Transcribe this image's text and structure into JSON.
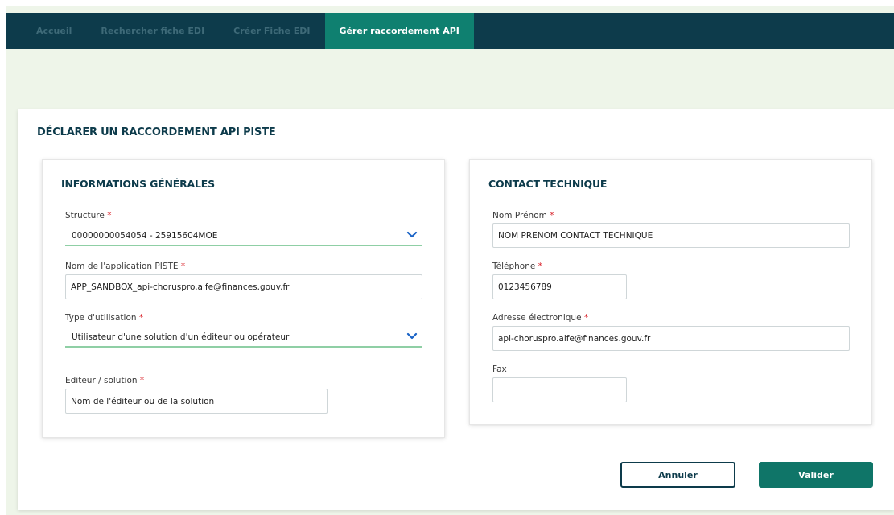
{
  "nav": {
    "tabs": [
      {
        "label": "Accueil",
        "active": false
      },
      {
        "label": "Rechercher fiche EDI",
        "active": false
      },
      {
        "label": "Créer Fiche EDI",
        "active": false
      },
      {
        "label": "Gérer raccordement API",
        "active": true
      }
    ]
  },
  "page": {
    "title": "DÉCLARER UN RACCORDEMENT API PISTE"
  },
  "general": {
    "title": "INFORMATIONS GÉNÉRALES",
    "structure": {
      "label": "Structure",
      "required": "*",
      "value": "00000000054054 - 25915604MOE"
    },
    "app_name": {
      "label": "Nom de l'application PISTE",
      "required": "*",
      "value": "APP_SANDBOX_api-choruspro.aife@finances.gouv.fr"
    },
    "usage_type": {
      "label": "Type d'utilisation",
      "required": "*",
      "value": "Utilisateur d'une solution d'un éditeur ou opérateur"
    },
    "editor": {
      "label": "Editeur / solution",
      "required": "*",
      "placeholder": "Nom de l'éditeur ou de la solution",
      "value": ""
    }
  },
  "contact": {
    "title": "CONTACT TECHNIQUE",
    "name": {
      "label": "Nom Prénom",
      "required": "*",
      "value": "NOM PRENOM CONTACT TECHNIQUE"
    },
    "phone": {
      "label": "Téléphone",
      "required": "*",
      "value": "0123456789"
    },
    "email": {
      "label": "Adresse électronique",
      "required": "*",
      "value": "api-choruspro.aife@finances.gouv.fr"
    },
    "fax": {
      "label": "Fax",
      "value": ""
    }
  },
  "actions": {
    "cancel_label": "Annuler",
    "submit_label": "Valider"
  },
  "colors": {
    "nav_bg": "#0d3b4b",
    "nav_active": "#0f8070",
    "accent": "#0f7568",
    "required": "#d9222a",
    "select_underline": "#8fcfa5"
  }
}
